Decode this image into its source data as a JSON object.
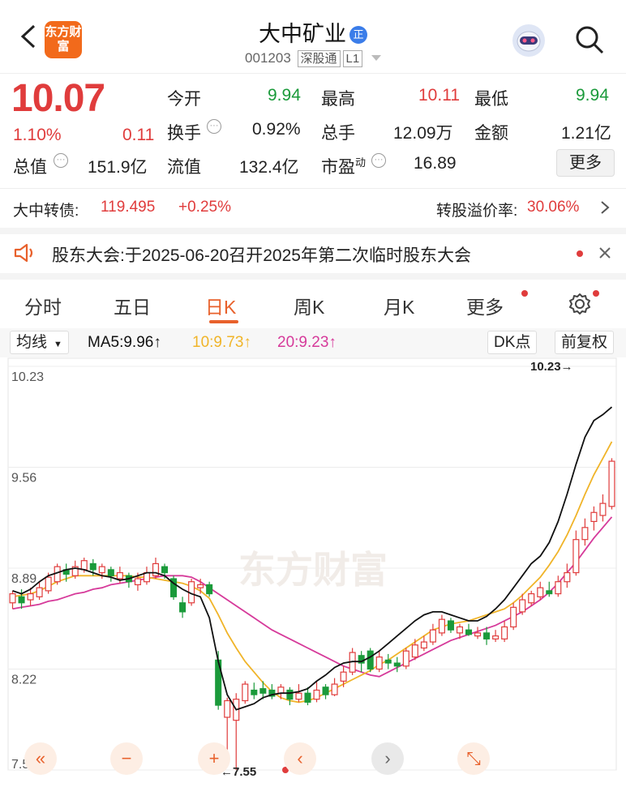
{
  "header": {
    "logo_text": "东方财富",
    "title": "大中矿业",
    "title_badge": "正",
    "code": "001203",
    "tag1": "深股通",
    "tag2": "L1",
    "icons": [
      "back-arrow-icon",
      "robot-avatar-icon",
      "search-icon",
      "dropdown-caret-icon"
    ]
  },
  "quote": {
    "price": "10.07",
    "change_pct": "1.10%",
    "change": "0.11",
    "open_label": "今开",
    "open": "9.94",
    "high_label": "最高",
    "high": "10.11",
    "low_label": "最低",
    "low": "9.94",
    "turnover_label": "换手",
    "turnover": "0.92%",
    "volume_label": "总手",
    "volume": "12.09万",
    "amount_label": "金额",
    "amount": "1.21亿",
    "mktcap_label": "总值",
    "mktcap": "151.9亿",
    "float_label": "流值",
    "float": "132.4亿",
    "pe_label": "市盈",
    "pe_sup": "动",
    "pe": "16.89",
    "more": "更多"
  },
  "bond": {
    "name": "大中转债:",
    "price": "119.495",
    "change": "+0.25%",
    "premium_label": "转股溢价率:",
    "premium": "30.06%"
  },
  "notice": {
    "text": "股东大会:于2025-06-20召开2025年第二次临时股东大会"
  },
  "tabs": [
    {
      "label": "分时"
    },
    {
      "label": "五日"
    },
    {
      "label": "日K"
    },
    {
      "label": "周K"
    },
    {
      "label": "月K"
    },
    {
      "label": "更多"
    }
  ],
  "ma": {
    "selector": "均线",
    "ma5": "MA5:9.96",
    "ma10": "10:9.73",
    "ma20": "20:9.23",
    "arrow": "↑",
    "dk": "DK点",
    "adjust": "前复权"
  },
  "colors": {
    "up": "#e03c3c",
    "down": "#1a9a3a",
    "ma5": "#111111",
    "ma10": "#f0b429",
    "ma20": "#d63a9a",
    "accent": "#e8612c"
  },
  "chart_data": {
    "type": "candlestick",
    "y_tick_labels": [
      "10.23",
      "9.56",
      "8.89",
      "8.22",
      "7.55"
    ],
    "ylim": [
      7.55,
      10.23
    ],
    "max_label": "10.23",
    "min_label": "7.55",
    "watermark": "东方财富",
    "ma5": [
      8.74,
      8.72,
      8.75,
      8.8,
      8.84,
      8.86,
      8.88,
      8.89,
      8.88,
      8.86,
      8.84,
      8.83,
      8.81,
      8.82,
      8.84,
      8.86,
      8.86,
      8.84,
      8.79,
      8.75,
      8.72,
      8.7,
      8.56,
      8.27,
      8.05,
      7.95,
      7.97,
      7.99,
      8.03,
      8.05,
      8.06,
      8.06,
      8.07,
      8.09,
      8.14,
      8.18,
      8.23,
      8.26,
      8.27,
      8.27,
      8.3,
      8.34,
      8.39,
      8.44,
      8.49,
      8.54,
      8.58,
      8.6,
      8.6,
      8.58,
      8.56,
      8.54,
      8.54,
      8.57,
      8.62,
      8.68,
      8.76,
      8.84,
      8.92,
      8.97,
      9.06,
      9.2,
      9.38,
      9.58,
      9.76,
      9.87,
      9.91,
      9.96
    ],
    "ma10": [
      8.7,
      8.71,
      8.72,
      8.74,
      8.77,
      8.8,
      8.82,
      8.84,
      8.84,
      8.84,
      8.84,
      8.84,
      8.84,
      8.84,
      8.83,
      8.83,
      8.82,
      8.81,
      8.8,
      8.79,
      8.77,
      8.74,
      8.69,
      8.58,
      8.46,
      8.36,
      8.27,
      8.2,
      8.13,
      8.07,
      8.03,
      8.01,
      8.0,
      8.01,
      8.03,
      8.06,
      8.09,
      8.12,
      8.15,
      8.18,
      8.21,
      8.25,
      8.28,
      8.32,
      8.36,
      8.4,
      8.44,
      8.48,
      8.5,
      8.52,
      8.53,
      8.54,
      8.56,
      8.58,
      8.6,
      8.62,
      8.66,
      8.71,
      8.77,
      8.83,
      8.91,
      9.0,
      9.11,
      9.24,
      9.38,
      9.51,
      9.62,
      9.73
    ],
    "ma20": [
      8.62,
      8.63,
      8.64,
      8.65,
      8.67,
      8.68,
      8.7,
      8.72,
      8.73,
      8.75,
      8.76,
      8.78,
      8.79,
      8.8,
      8.81,
      8.82,
      8.83,
      8.84,
      8.84,
      8.84,
      8.83,
      8.8,
      8.76,
      8.72,
      8.68,
      8.64,
      8.6,
      8.56,
      8.52,
      8.48,
      8.45,
      8.42,
      8.39,
      8.36,
      8.33,
      8.3,
      8.27,
      8.24,
      8.22,
      8.2,
      8.18,
      8.17,
      8.2,
      8.23,
      8.26,
      8.29,
      8.32,
      8.35,
      8.38,
      8.41,
      8.43,
      8.45,
      8.47,
      8.49,
      8.51,
      8.54,
      8.57,
      8.6,
      8.64,
      8.68,
      8.73,
      8.79,
      8.86,
      8.93,
      9.01,
      9.09,
      9.16,
      9.23
    ],
    "candles": [
      [
        8.66,
        8.72,
        8.74,
        8.62
      ],
      [
        8.7,
        8.66,
        8.75,
        8.62
      ],
      [
        8.68,
        8.72,
        8.76,
        8.64
      ],
      [
        8.7,
        8.76,
        8.8,
        8.68
      ],
      [
        8.74,
        8.83,
        8.86,
        8.72
      ],
      [
        8.8,
        8.9,
        8.92,
        8.78
      ],
      [
        8.88,
        8.85,
        8.92,
        8.8
      ],
      [
        8.84,
        8.9,
        8.94,
        8.82
      ],
      [
        8.88,
        8.94,
        8.96,
        8.86
      ],
      [
        8.92,
        8.88,
        8.95,
        8.84
      ],
      [
        8.86,
        8.9,
        8.92,
        8.82
      ],
      [
        8.88,
        8.84,
        8.9,
        8.8
      ],
      [
        8.82,
        8.86,
        8.9,
        8.79
      ],
      [
        8.84,
        8.8,
        8.86,
        8.76
      ],
      [
        8.78,
        8.82,
        8.86,
        8.74
      ],
      [
        8.8,
        8.86,
        8.9,
        8.78
      ],
      [
        8.84,
        8.92,
        8.96,
        8.82
      ],
      [
        8.9,
        8.86,
        8.92,
        8.82
      ],
      [
        8.82,
        8.7,
        8.84,
        8.68
      ],
      [
        8.66,
        8.6,
        8.7,
        8.56
      ],
      [
        8.66,
        8.8,
        8.82,
        8.64
      ],
      [
        8.76,
        8.78,
        8.82,
        8.72
      ],
      [
        8.78,
        8.72,
        8.8,
        8.7
      ],
      [
        8.28,
        7.98,
        8.34,
        7.95
      ],
      [
        7.9,
        8.01,
        8.03,
        7.62
      ],
      [
        7.88,
        8.02,
        8.06,
        7.55
      ],
      [
        8.01,
        8.12,
        8.14,
        7.99
      ],
      [
        8.08,
        8.05,
        8.13,
        8.02
      ],
      [
        8.09,
        8.06,
        8.14,
        8.02
      ],
      [
        8.08,
        8.04,
        8.12,
        8.02
      ],
      [
        8.06,
        8.1,
        8.12,
        8.02
      ],
      [
        8.08,
        8.02,
        8.1,
        7.98
      ],
      [
        8.02,
        8.06,
        8.12,
        8.0
      ],
      [
        8.06,
        8.0,
        8.1,
        7.98
      ],
      [
        8.02,
        8.08,
        8.14,
        8.0
      ],
      [
        8.1,
        8.05,
        8.12,
        8.02
      ],
      [
        8.05,
        8.12,
        8.16,
        8.04
      ],
      [
        8.14,
        8.2,
        8.24,
        8.1
      ],
      [
        8.2,
        8.33,
        8.36,
        8.18
      ],
      [
        8.31,
        8.26,
        8.34,
        8.2
      ],
      [
        8.34,
        8.22,
        8.36,
        8.2
      ],
      [
        8.22,
        8.3,
        8.34,
        8.2
      ],
      [
        8.28,
        8.26,
        8.32,
        8.22
      ],
      [
        8.26,
        8.24,
        8.3,
        8.2
      ],
      [
        8.24,
        8.34,
        8.36,
        8.22
      ],
      [
        8.3,
        8.38,
        8.42,
        8.28
      ],
      [
        8.36,
        8.4,
        8.44,
        8.34
      ],
      [
        8.4,
        8.48,
        8.52,
        8.38
      ],
      [
        8.46,
        8.55,
        8.58,
        8.44
      ],
      [
        8.54,
        8.48,
        8.56,
        8.46
      ],
      [
        8.46,
        8.5,
        8.52,
        8.42
      ],
      [
        8.48,
        8.45,
        8.52,
        8.44
      ],
      [
        8.44,
        8.46,
        8.5,
        8.42
      ],
      [
        8.46,
        8.42,
        8.5,
        8.38
      ],
      [
        8.42,
        8.44,
        8.48,
        8.4
      ],
      [
        8.42,
        8.5,
        8.54,
        8.4
      ],
      [
        8.5,
        8.63,
        8.66,
        8.48
      ],
      [
        8.6,
        8.68,
        8.72,
        8.58
      ],
      [
        8.66,
        8.72,
        8.74,
        8.64
      ],
      [
        8.7,
        8.76,
        8.8,
        8.68
      ],
      [
        8.74,
        8.72,
        8.8,
        8.7
      ],
      [
        8.72,
        8.8,
        8.84,
        8.7
      ],
      [
        8.8,
        8.86,
        8.92,
        8.76
      ],
      [
        8.86,
        9.08,
        9.14,
        8.84
      ],
      [
        9.08,
        9.16,
        9.22,
        9.04
      ],
      [
        9.2,
        9.26,
        9.3,
        9.14
      ],
      [
        9.24,
        9.32,
        9.38,
        9.2
      ],
      [
        9.3,
        9.6,
        9.62,
        9.28
      ]
    ]
  },
  "controls": [
    {
      "label": "«",
      "icon": "rewind-icon"
    },
    {
      "label": "−",
      "icon": "zoom-out-icon"
    },
    {
      "label": "+",
      "icon": "zoom-in-icon"
    },
    {
      "label": "‹",
      "icon": "prev-icon"
    },
    {
      "label": "›",
      "icon": "next-icon"
    },
    {
      "label": "⤡",
      "icon": "expand-icon"
    }
  ]
}
